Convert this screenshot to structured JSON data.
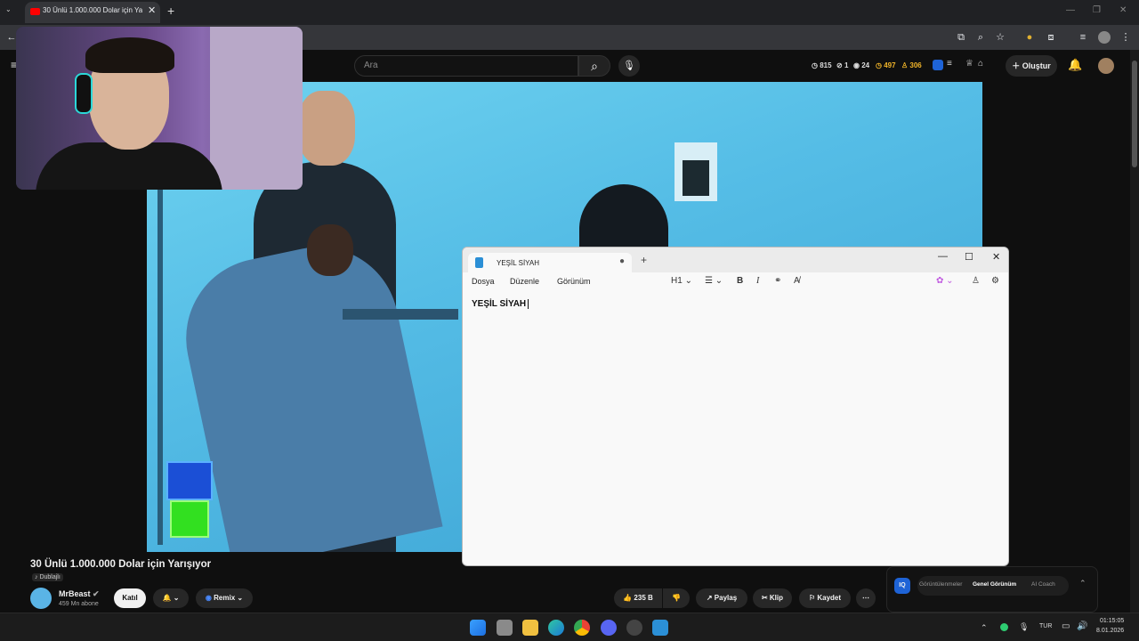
{
  "browser": {
    "tab_title": "30 Ünlü 1.000.000 Dolar için Ya",
    "tab_close": "✕",
    "new_tab": "+"
  },
  "youtube": {
    "search_placeholder": "Ara",
    "stats": {
      "clock": "815",
      "eye_hidden": "1",
      "eye": "24",
      "coins": "497",
      "users": "306"
    },
    "create_label": "Oluştur"
  },
  "notepad": {
    "tab_title": "YEŞİL SİYAH",
    "menus": [
      "Dosya",
      "Düzenle",
      "Görünüm"
    ],
    "heading_select": "H1",
    "content": "YEŞİL SİYAH"
  },
  "video": {
    "title": "30 Ünlü 1.000.000 Dolar için Yarışıyor",
    "dub_badge": "Dublajlı",
    "channel_name": "MrBeast",
    "subscribers": "459 Mn abone",
    "join_label": "Katıl",
    "remix_label": "Remix",
    "likes": "235 B",
    "share_label": "Paylaş",
    "clip_label": "Klip",
    "save_label": "Kaydet"
  },
  "iq_panel": {
    "logo": "IQ",
    "tabs": [
      "Görüntülenmeler",
      "Genel Görünüm",
      "AI Coach"
    ],
    "active_tab": "Genel Görünüm"
  },
  "taskbar": {
    "language": "TUR",
    "time": "01:15:05",
    "date": "8.01.2026"
  },
  "colors": {
    "accent_red": "#ff0000",
    "notepad_bg": "#f9f9f9",
    "video_sky": "#55bde6"
  }
}
